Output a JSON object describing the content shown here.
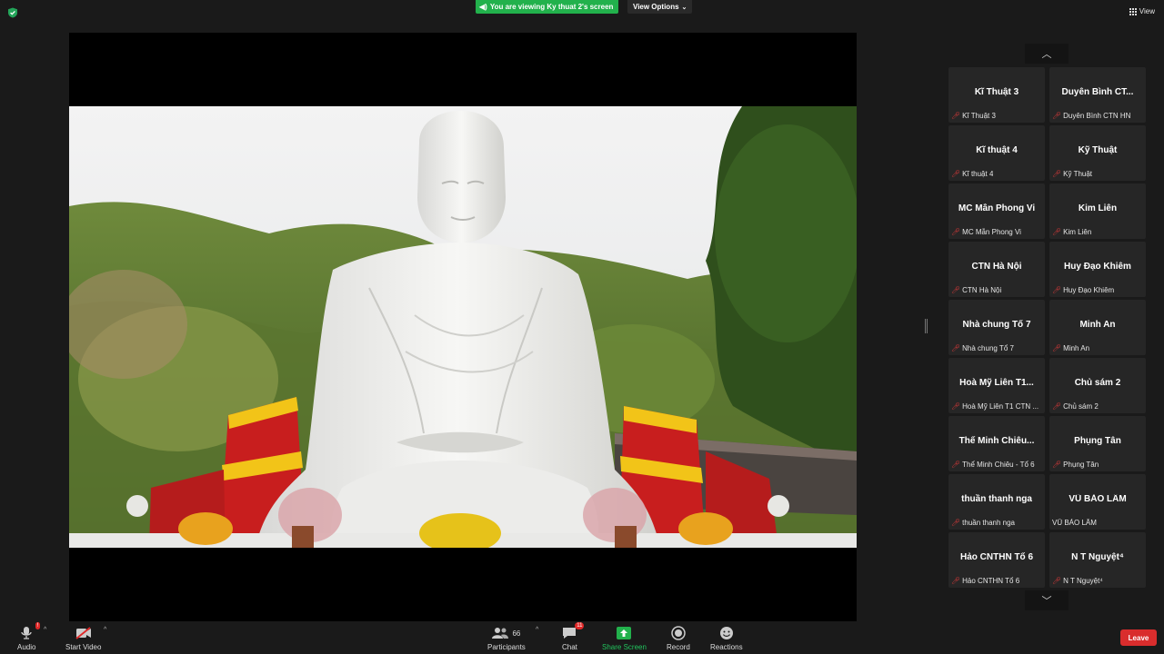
{
  "app": {
    "banner_text": "You are viewing Ky thuat 2's screen",
    "view_options_label": "View Options",
    "view_label": "View",
    "icons": {
      "security": "shield-icon",
      "banner": "speaker-icon",
      "view": "grid-icon"
    },
    "colors": {
      "banner": "#22b14c",
      "leave": "#d92d2d",
      "mute": "#e03a3a",
      "share_screen": "#22b14c"
    }
  },
  "gallery": {
    "tiles": [
      {
        "display": "Kĩ Thuật 3",
        "name": "Kĩ Thuật 3"
      },
      {
        "display": "Duyên Bình  CT...",
        "name": "Duyên Bình  CTN HN"
      },
      {
        "display": "Kĩ thuật 4",
        "name": "Kĩ thuật 4"
      },
      {
        "display": "Kỹ Thuật",
        "name": "Kỹ Thuật"
      },
      {
        "display": "MC Mẫn Phong Vi",
        "name": "MC Mẫn Phong Vi"
      },
      {
        "display": "Kim Liên",
        "name": "Kim Liên"
      },
      {
        "display": "CTN Hà Nội",
        "name": "CTN Hà Nội"
      },
      {
        "display": "Huy Đạo Khiêm",
        "name": "Huy Đạo Khiêm"
      },
      {
        "display": "Nhà chung Tổ 7",
        "name": "Nhà chung Tổ 7"
      },
      {
        "display": "Minh An",
        "name": "Minh An"
      },
      {
        "display": "Hoà Mỹ Liên T1...",
        "name": "Hoà Mỹ Liên T1 CTN ..."
      },
      {
        "display": "Chủ sám 2",
        "name": "Chủ sám 2"
      },
      {
        "display": "Thể Minh Chiêu...",
        "name": "Thể Minh Chiêu - Tổ 6"
      },
      {
        "display": "Phụng Tân",
        "name": "Phụng Tân"
      },
      {
        "display": "thuần thanh nga",
        "name": "thuần thanh nga"
      },
      {
        "display": "VŨ BẢO LÂM",
        "name": "VŨ BẢO LÂM"
      },
      {
        "display": "Hảo CNTHN Tổ 6",
        "name": "Hảo CNTHN Tổ 6"
      },
      {
        "display": "N T Nguyệt⁴",
        "name": "N T Nguyệt⁴"
      }
    ]
  },
  "toolbar": {
    "audio_label": "Audio",
    "audio_badge": "!",
    "video_label": "Start Video",
    "participants_label": "Participants",
    "participants_count": "66",
    "chat_label": "Chat",
    "chat_badge": "11",
    "share_label": "Share Screen",
    "record_label": "Record",
    "reactions_label": "Reactions",
    "leave_label": "Leave"
  }
}
